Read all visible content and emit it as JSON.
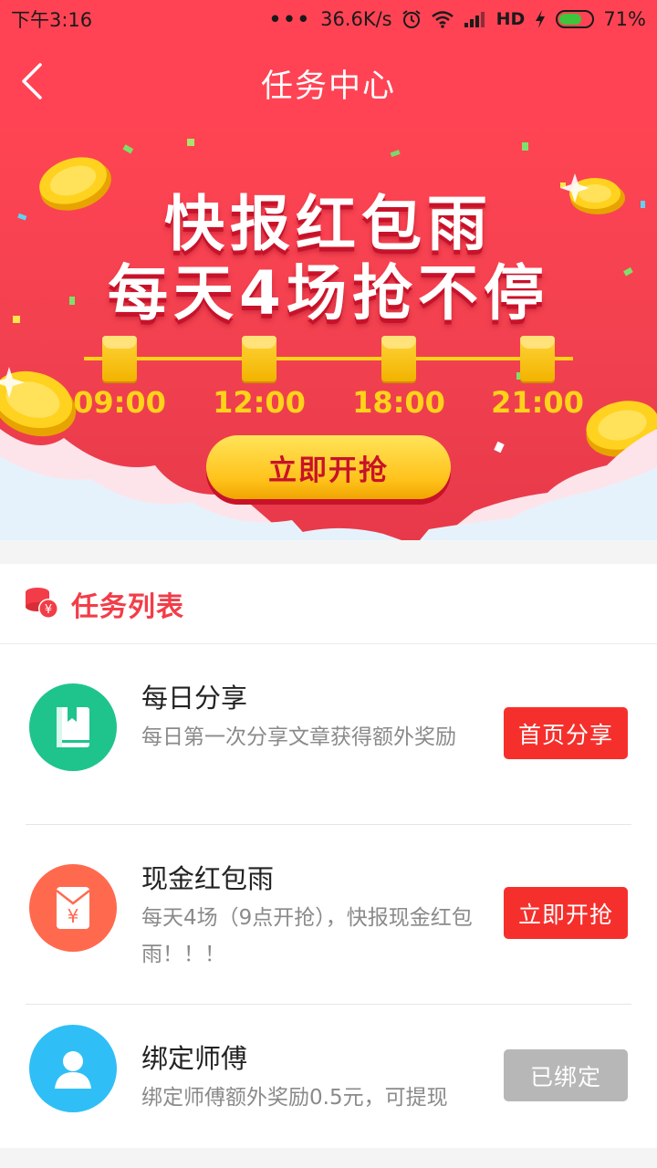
{
  "status_bar": {
    "time": "下午3:16",
    "dots": "•••",
    "network_speed": "36.6K/s",
    "hd": "HD",
    "battery_percent": "71%",
    "battery_level": 0.71,
    "icons": [
      "alarm-icon",
      "wifi-icon",
      "signal-icon",
      "charging-icon",
      "battery-icon"
    ]
  },
  "nav": {
    "back_icon": "chevron-left-icon",
    "title": "任务中心"
  },
  "banner": {
    "headline_1": "快报红包雨",
    "headline_2": "每天4场抢不停",
    "times": [
      "09:00",
      "12:00",
      "18:00",
      "21:00"
    ],
    "button_label": "立即开抢",
    "colors": {
      "background": "#ff4354",
      "gold": "#ffd319",
      "text_shadow": "#c8122a"
    }
  },
  "task_list": {
    "header_icon": "coin-stack-icon",
    "header_title": "任务列表",
    "items": [
      {
        "icon": "book-icon",
        "icon_color": "#1fc48c",
        "title": "每日分享",
        "description": "每日第一次分享文章获得额外奖励",
        "button_label": "首页分享",
        "button_state": "active"
      },
      {
        "icon": "red-envelope-icon",
        "icon_color": "#ff6a4f",
        "title": "现金红包雨",
        "description": "每天4场（9点开抢），快报现金红包雨！！！",
        "button_label": "立即开抢",
        "button_state": "active"
      },
      {
        "icon": "user-icon",
        "icon_color": "#2fbff6",
        "title": "绑定师傅",
        "description": "绑定师傅额外奖励0.5元，可提现",
        "button_label": "已绑定",
        "button_state": "done"
      }
    ]
  }
}
